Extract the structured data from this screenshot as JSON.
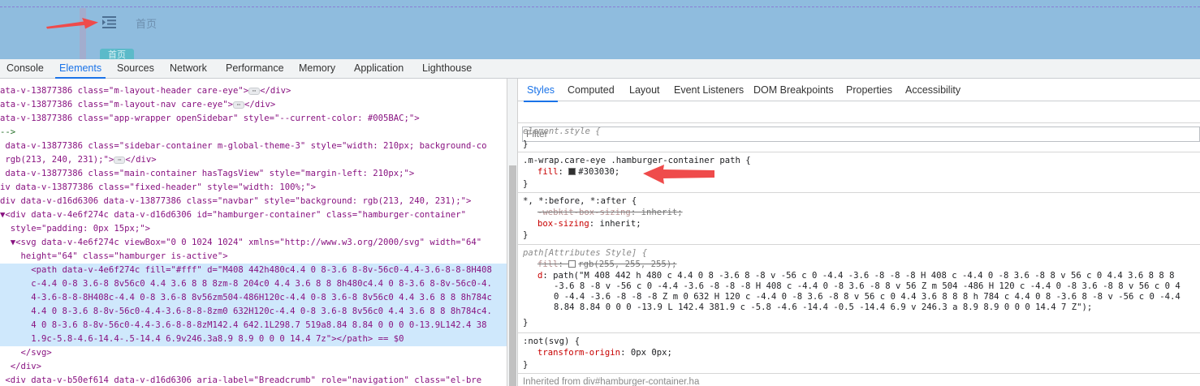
{
  "preview": {
    "home_label": "首页",
    "tag_label": "首页",
    "colors": {
      "background": "#8fbcde",
      "arrow": "#ef4b4b",
      "tag": "#5bbac9"
    }
  },
  "devtools_tabs": [
    {
      "label": "Console",
      "active": false
    },
    {
      "label": "Elements",
      "active": true
    },
    {
      "label": "Sources",
      "active": false
    },
    {
      "label": "Network",
      "active": false
    },
    {
      "label": "Performance",
      "active": false
    },
    {
      "label": "Memory",
      "active": false
    },
    {
      "label": "Application",
      "active": false
    },
    {
      "label": "Lighthouse",
      "active": false
    }
  ],
  "elements_lines": [
    "ata-v-13877386 class=\"m-layout-header care-eye\">",
    "ata-v-13877386 class=\"m-layout-nav care-eye\">",
    "ata-v-13877386 class=\"app-wrapper openSidebar\" style=\"--current-color: #005BAC;\">",
    "-->",
    " data-v-13877386 class=\"sidebar-container m-global-theme-3\" style=\"width: 210px; background-co",
    " rgb(213, 240, 231);\">",
    " data-v-13877386 class=\"main-container hasTagsView\" style=\"margin-left: 210px;\">",
    "iv data-v-13877386 class=\"fixed-header\" style=\"width: 100%;\">",
    "div data-v-d16d6306 data-v-13877386 class=\"navbar\" style=\"background: rgb(213, 240, 231);\">",
    "▼<div data-v-4e6f274c data-v-d16d6306 id=\"hamburger-container\" class=\"hamburger-container\"",
    "  style=\"padding: 0px 15px;\">",
    "  ▼<svg data-v-4e6f274c viewBox=\"0 0 1024 1024\" xmlns=\"http://www.w3.org/2000/svg\" width=\"64\"",
    "    height=\"64\" class=\"hamburger is-active\">",
    "      <path data-v-4e6f274c fill=\"#fff\" d=\"M408 442h480c4.4 0 8-3.6 8-8v-56c0-4.4-3.6-8-8-8H408",
    "      c-4.4 0-8 3.6-8 8v56c0 4.4 3.6 8 8 8zm-8 204c0 4.4 3.6 8 8 8h480c4.4 0 8-3.6 8-8v-56c0-4.",
    "      4-3.6-8-8-8H408c-4.4 0-8 3.6-8 8v56zm504-486H120c-4.4 0-8 3.6-8 8v56c0 4.4 3.6 8 8 8h784c",
    "      4.4 0 8-3.6 8-8v-56c0-4.4-3.6-8-8-8zm0 632H120c-4.4 0-8 3.6-8 8v56c0 4.4 3.6 8 8 8h784c4.",
    "      4 0 8-3.6 8-8v-56c0-4.4-3.6-8-8-8zM142.4 642.1L298.7 519a8.84 8.84 0 0 0 0-13.9L142.4 38",
    "      1.9c-5.8-4.6-14.4-.5-14.4 6.9v246.3a8.9 8.9 0 0 0 14.4 7z\"></path> == $0",
    "    </svg>",
    "  </div>",
    " <div data-v-b50ef614 data-v-d16d6306 aria-label=\"Breadcrumb\" role=\"navigation\" class=\"el-bre"
  ],
  "styles_tabs": [
    {
      "label": "Styles",
      "active": true
    },
    {
      "label": "Computed",
      "active": false
    },
    {
      "label": "Layout",
      "active": false
    },
    {
      "label": "Event Listeners",
      "active": false
    },
    {
      "label": "DOM Breakpoints",
      "active": false
    },
    {
      "label": "Properties",
      "active": false
    },
    {
      "label": "Accessibility",
      "active": false
    }
  ],
  "filter_placeholder": "Filter",
  "rules": {
    "element_style": "element.style {",
    "close": "}",
    "care_eye_selector": ".m-wrap.care-eye .hamburger-container path {",
    "fill_prop": "fill",
    "fill_value": "#303030;",
    "fill_color": "#303030",
    "universal_selector": "*, *:before, *:after {",
    "webkit_prop": "-webkit-box-sizing",
    "webkit_value": "inherit;",
    "boxsizing_prop": "box-sizing",
    "boxsizing_value": "inherit;",
    "attr_selector": "path[Attributes Style] {",
    "attr_fill_prop": "fill",
    "attr_fill_value": "rgb(255, 255, 255);",
    "attr_fill_color": "#ffffff",
    "d_prop": "d",
    "d_line1": "path(\"M 408 442 h 480 c 4.4 0 8 -3.6 8 -8 v -56 c 0 -4.4 -3.6 -8 -8 -8 H 408 c -4.4 0 -8 3.6 -8 8 v 56 c 0 4.4 3.6 8 8 8",
    "d_line2": "-3.6 8 -8 v -56 c 0 -4.4 -3.6 -8 -8 -8 H 408 c -4.4 0 -8 3.6 -8 8 v 56 Z m 504 -486 H 120 c -4.4 0 -8 3.6 -8 8 v 56 c 0 4",
    "d_line3": "0 -4.4 -3.6 -8 -8 -8 Z m 0 632 H 120 c -4.4 0 -8 3.6 -8 8 v 56 c 0 4.4 3.6 8 8 8 h 784 c 4.4 0 8 -3.6 8 -8 v -56 c 0 -4.4",
    "d_line4": "8.84 8.84 0 0 0 -13.9 L 142.4 381.9 c -5.8 -4.6 -14.4 -0.5 -14.4 6.9 v 246.3 a 8.9 8.9 0 0 0 14.4 7 Z\");",
    "notsvg_selector": ":not(svg) {",
    "transform_prop": "transform-origin",
    "transform_value": "0px 0px;",
    "inherited_text": "Inherited from div#hamburger-container.ha"
  }
}
